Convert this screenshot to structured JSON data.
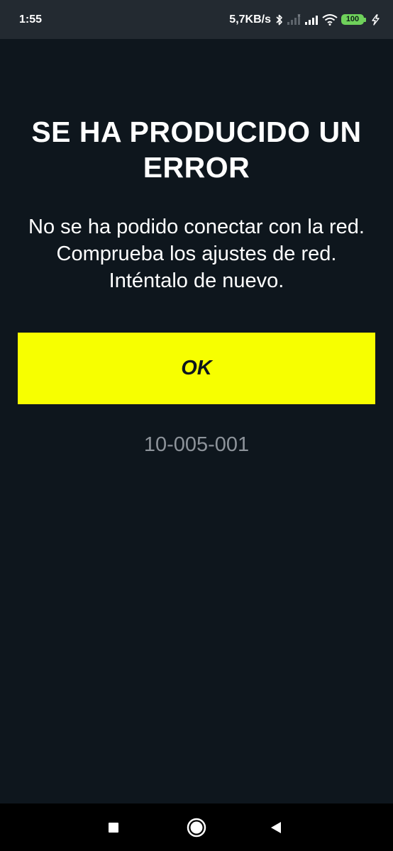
{
  "status_bar": {
    "time": "1:55",
    "network_speed": "5,7KB/s",
    "battery_level": "100",
    "icons": [
      "bluetooth-icon",
      "signal-empty-icon",
      "signal-icon",
      "wifi-icon",
      "battery-icon",
      "charging-icon"
    ],
    "colors": {
      "battery": "#6fd15b"
    }
  },
  "error_dialog": {
    "title": "SE HA PRODUCIDO UN ERROR",
    "message": "No se ha podido conectar con la red. Comprueba los ajustes de red. Inténtalo de nuevo.",
    "ok_label": "OK",
    "error_code": "10-005-001",
    "colors": {
      "background": "#0e161d",
      "button": "#f7ff00",
      "code_text": "#8d939a"
    }
  },
  "nav_bar": {
    "buttons": [
      "recents-button",
      "home-button",
      "back-button"
    ]
  }
}
